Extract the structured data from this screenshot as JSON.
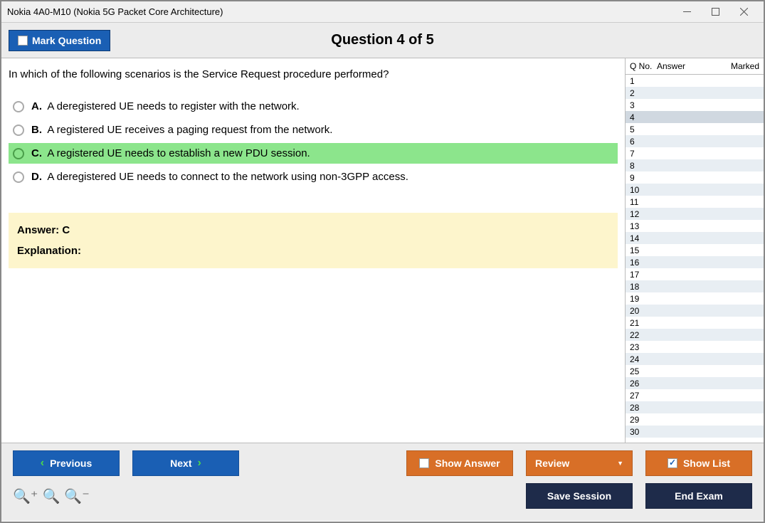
{
  "window": {
    "title": "Nokia 4A0-M10 (Nokia 5G Packet Core Architecture)"
  },
  "header": {
    "mark_label": "Mark Question",
    "question_title": "Question 4 of 5"
  },
  "question": {
    "text": "In which of the following scenarios is the Service Request procedure performed?",
    "choices": [
      {
        "letter": "A.",
        "text": "A deregistered UE needs to register with the network.",
        "selected": false
      },
      {
        "letter": "B.",
        "text": "A registered UE receives a paging request from the network.",
        "selected": false
      },
      {
        "letter": "C.",
        "text": "A registered UE needs to establish a new PDU session.",
        "selected": true
      },
      {
        "letter": "D.",
        "text": "A deregistered UE needs to connect to the network using non-3GPP access.",
        "selected": false
      }
    ],
    "answer_label": "Answer: C",
    "explanation_label": "Explanation:"
  },
  "sidebar": {
    "col_qno": "Q No.",
    "col_answer": "Answer",
    "col_marked": "Marked",
    "rows": [
      1,
      2,
      3,
      4,
      5,
      6,
      7,
      8,
      9,
      10,
      11,
      12,
      13,
      14,
      15,
      16,
      17,
      18,
      19,
      20,
      21,
      22,
      23,
      24,
      25,
      26,
      27,
      28,
      29,
      30
    ],
    "current": 4
  },
  "footer": {
    "previous": "Previous",
    "next": "Next",
    "show_answer": "Show Answer",
    "review": "Review",
    "show_list": "Show List",
    "save_session": "Save Session",
    "end_exam": "End Exam"
  }
}
